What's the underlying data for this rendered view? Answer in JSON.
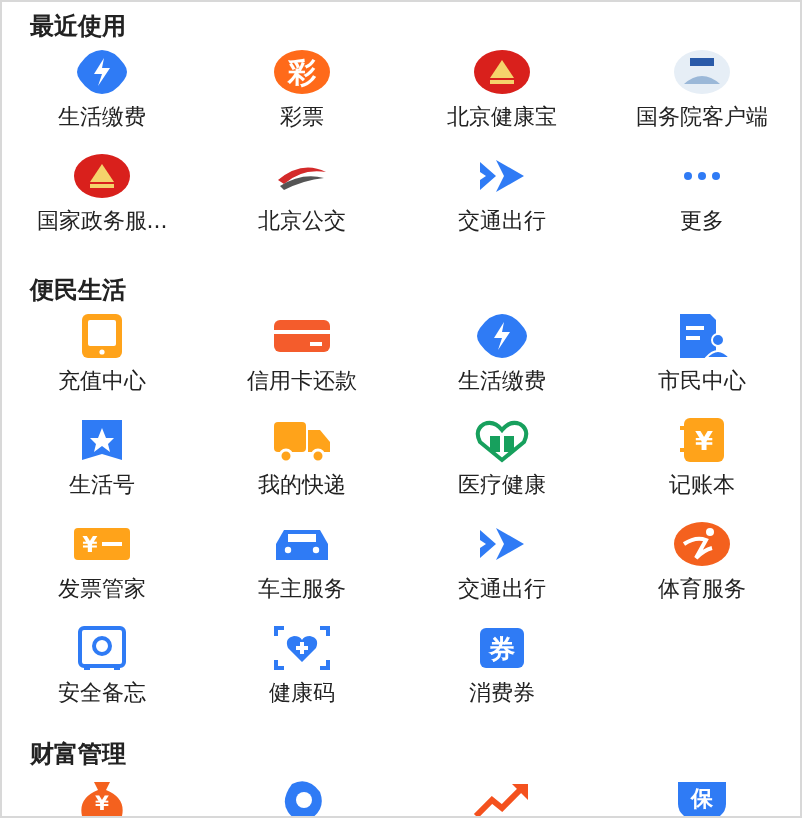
{
  "sections": [
    {
      "title": "最近使用",
      "items": [
        {
          "label": "生活缴费",
          "icon": {
            "kind": "bolt"
          }
        },
        {
          "label": "彩票",
          "icon": {
            "kind": "char-circle",
            "glyph": "彩"
          }
        },
        {
          "label": "北京健康宝",
          "icon": {
            "kind": "emblem"
          }
        },
        {
          "label": "国务院客户端",
          "icon": {
            "kind": "gov-client"
          }
        },
        {
          "label": "国家政务服...",
          "icon": {
            "kind": "emblem"
          }
        },
        {
          "label": "北京公交",
          "icon": {
            "kind": "bus"
          }
        },
        {
          "label": "交通出行",
          "icon": {
            "kind": "arrows"
          }
        },
        {
          "label": "更多",
          "icon": {
            "kind": "dots"
          }
        }
      ]
    },
    {
      "title": "便民生活",
      "items": [
        {
          "label": "充值中心",
          "icon": {
            "kind": "tablet"
          }
        },
        {
          "label": "信用卡还款",
          "icon": {
            "kind": "card"
          }
        },
        {
          "label": "生活缴费",
          "icon": {
            "kind": "bolt"
          }
        },
        {
          "label": "市民中心",
          "icon": {
            "kind": "doc-person"
          }
        },
        {
          "label": "生活号",
          "icon": {
            "kind": "bookmark"
          }
        },
        {
          "label": "我的快递",
          "icon": {
            "kind": "truck"
          }
        },
        {
          "label": "医疗健康",
          "icon": {
            "kind": "heart-house"
          }
        },
        {
          "label": "记账本",
          "icon": {
            "kind": "notebook",
            "glyph": "¥"
          }
        },
        {
          "label": "发票管家",
          "icon": {
            "kind": "ticket",
            "glyph": "¥"
          }
        },
        {
          "label": "车主服务",
          "icon": {
            "kind": "car"
          }
        },
        {
          "label": "交通出行",
          "icon": {
            "kind": "arrows"
          }
        },
        {
          "label": "体育服务",
          "icon": {
            "kind": "runner"
          }
        },
        {
          "label": "安全备忘",
          "icon": {
            "kind": "safe"
          }
        },
        {
          "label": "健康码",
          "icon": {
            "kind": "health-code"
          }
        },
        {
          "label": "消费券",
          "icon": {
            "kind": "coupon",
            "glyph": "券"
          }
        }
      ]
    },
    {
      "title": "财富管理",
      "items": [
        {
          "icon": {
            "kind": "bag",
            "glyph": "¥"
          }
        },
        {
          "icon": {
            "kind": "drop"
          }
        },
        {
          "icon": {
            "kind": "chart"
          }
        },
        {
          "icon": {
            "kind": "shield",
            "glyph": "保"
          }
        }
      ]
    }
  ]
}
